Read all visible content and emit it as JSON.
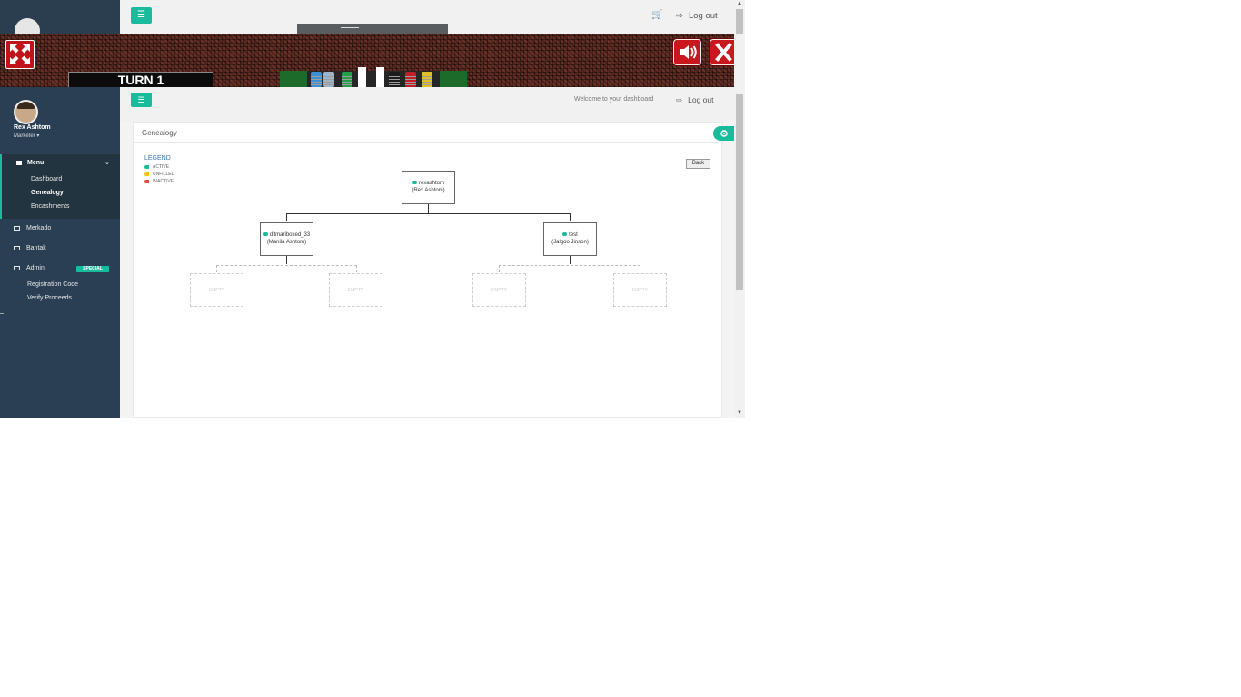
{
  "background_page": {
    "logout_label": "Log out"
  },
  "game": {
    "turn_label": "TURN 1",
    "chip_colors": [
      "#3b8fd4",
      "#9fb3c4",
      "#22a046",
      "#e9e9e9",
      "#1c1c1c",
      "#c61c26",
      "#e0c028"
    ]
  },
  "sidebar": {
    "user_name": "Rex Ashtom",
    "user_role": "Marketer",
    "menu_label": "Menu",
    "menu_items": [
      "Dashboard",
      "Genealogy",
      "Encashments"
    ],
    "active_item": "Genealogy",
    "items": [
      "Merkado",
      "Bantak",
      "Admin"
    ],
    "admin_badge": "SPECIAL",
    "admin_items": [
      "Registration Code",
      "Verify Proceeds"
    ]
  },
  "topnav": {
    "welcome_text": "Welcome to your dashboard",
    "logout_label": "Log out"
  },
  "panel": {
    "title": "Genealogy",
    "legend": {
      "title": "LEGEND",
      "entries": [
        {
          "label": "ACTIVE",
          "color": "#1abb9c"
        },
        {
          "label": "UNFILLED",
          "color": "#f0c419"
        },
        {
          "label": "INACTIVE",
          "color": "#e74c3c"
        }
      ]
    },
    "back_label": "Back",
    "tree": {
      "root": {
        "username": "rexashtom",
        "name": "(Rex Ashtom)"
      },
      "left": {
        "username": "ditmariboxed_33",
        "name": "(Manila Ashtom)"
      },
      "right": {
        "username": "test",
        "name": "(Jalgoo Jinson)"
      },
      "empty_label": "EMPTY"
    }
  },
  "colors": {
    "sidebar": "#2a3f54",
    "accent": "#1abb9c",
    "game_button": "#c8171d"
  }
}
